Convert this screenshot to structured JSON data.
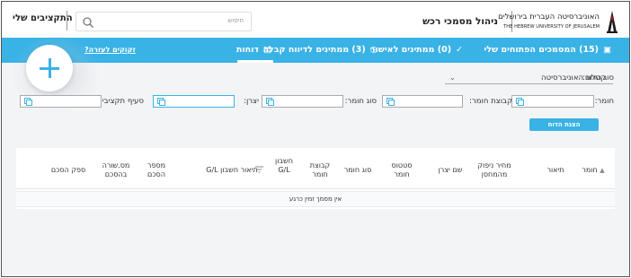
{
  "header": {
    "my_budgets": "התקציבים שלי",
    "search_placeholder": "חיפוש",
    "app_title": "ניהול מסמכי רכש",
    "university_hebrew": "האוניברסיטה העברית בירושלים",
    "university_english": "THE HEBREW UNIVERSITY OF JERUSALEM"
  },
  "nav": {
    "items": [
      {
        "label": "(15) המסמכים הפתוחים שלי",
        "icon": "document-icon"
      },
      {
        "label": "(0) ממתינים לאישור",
        "icon": "check-circle-icon"
      },
      {
        "label": "(3) ממתינים לדיווח קבלה",
        "icon": "clock-icon"
      },
      {
        "label": "דוחות",
        "icon": "report-icon"
      }
    ],
    "active_index": 3,
    "help_link": "זקוקים לעזרה?"
  },
  "filters": {
    "report_type_label": "סוג הדוח:",
    "report_type_value": "קטלוג האוניברסיטה",
    "material_label": "חומר:",
    "material_group_label": "קבוצת חומר:",
    "material_type_label": "סוג חומר:",
    "manufacturer_label": "יצרן:",
    "budget_section_label": "סעיף תקציבי:",
    "show_report_button": "הצגת הדוח"
  },
  "table": {
    "columns": [
      "חומר",
      "תיאור",
      "מחיר ניפוק מהמחסן",
      "שם יצרן",
      "סטטוס חומר",
      "סוג חומר",
      "קבוצת חומר",
      "חשבון G/L",
      "תיאור חשבון G/L",
      "מספר הסכם",
      "מס.שורה בהסכם",
      "ספק הסכם"
    ],
    "empty_message": "אין מסמך זמין כרגע"
  },
  "colors": {
    "accent": "#39b2e6"
  }
}
